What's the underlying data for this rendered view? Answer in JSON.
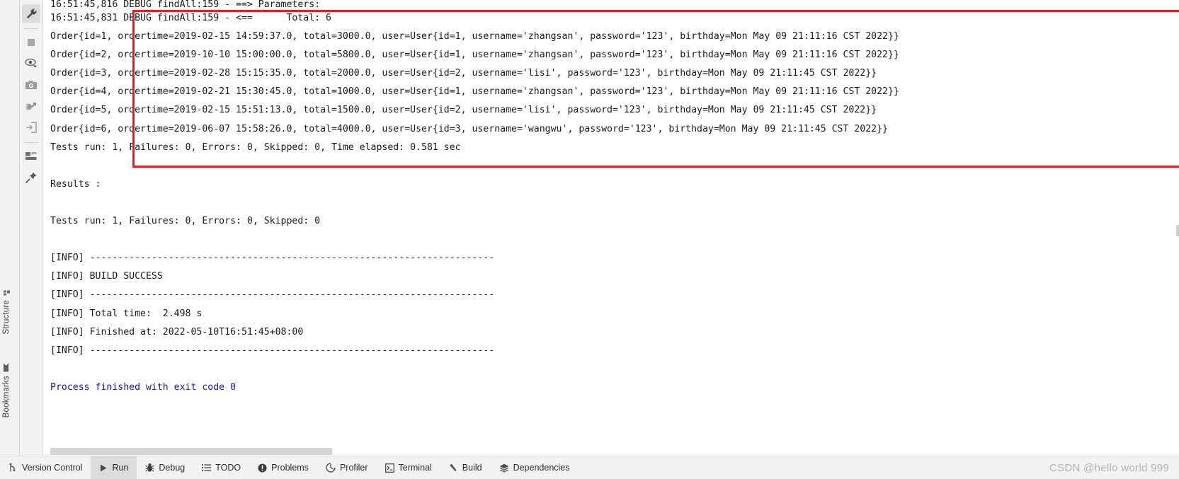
{
  "left_strip": {
    "structure_label": "Structure",
    "bookmarks_label": "Bookmarks",
    "structure_icon": "structure-icon",
    "bookmarks_icon": "bookmark-icon"
  },
  "run_gutter": {
    "buttons": [
      {
        "name": "settings-wrench-icon",
        "title": "Settings",
        "active": true
      },
      {
        "name": "stop-icon",
        "title": "Stop",
        "active": false
      },
      {
        "name": "eye-icon",
        "title": "Filter",
        "active": false
      },
      {
        "name": "camera-icon",
        "title": "Print Screen",
        "active": false
      },
      {
        "name": "rerun-failed-tests-icon",
        "title": "Rerun Failed Tests",
        "active": false
      },
      {
        "name": "export-icon",
        "title": "Export Test Results",
        "active": false
      },
      {
        "name": "layout-icon",
        "title": "Layout",
        "active": false
      },
      {
        "name": "pin-icon",
        "title": "Pin Tab",
        "active": false
      }
    ]
  },
  "console": {
    "lines": [
      {
        "text": "16:51:45,816 DEBUG findAll:159 - ==> Parameters:",
        "style": "plain",
        "clipped": true
      },
      {
        "text": "16:51:45,831 DEBUG findAll:159 - <==      Total: 6",
        "style": "plain"
      },
      {
        "text": "Order{id=1, ordertime=2019-02-15 14:59:37.0, total=3000.0, user=User{id=1, username='zhangsan', password='123', birthday=Mon May 09 21:11:16 CST 2022}}",
        "style": "plain"
      },
      {
        "text": "Order{id=2, ordertime=2019-10-10 15:00:00.0, total=5800.0, user=User{id=1, username='zhangsan', password='123', birthday=Mon May 09 21:11:16 CST 2022}}",
        "style": "plain"
      },
      {
        "text": "Order{id=3, ordertime=2019-02-28 15:15:35.0, total=2000.0, user=User{id=2, username='lisi', password='123', birthday=Mon May 09 21:11:45 CST 2022}}",
        "style": "plain"
      },
      {
        "text": "Order{id=4, ordertime=2019-02-21 15:30:45.0, total=1000.0, user=User{id=1, username='zhangsan', password='123', birthday=Mon May 09 21:11:16 CST 2022}}",
        "style": "plain"
      },
      {
        "text": "Order{id=5, ordertime=2019-02-15 15:51:13.0, total=1500.0, user=User{id=2, username='lisi', password='123', birthday=Mon May 09 21:11:45 CST 2022}}",
        "style": "plain"
      },
      {
        "text": "Order{id=6, ordertime=2019-06-07 15:58:26.0, total=4000.0, user=User{id=3, username='wangwu', password='123', birthday=Mon May 09 21:11:45 CST 2022}}",
        "style": "plain"
      },
      {
        "text": "Tests run: 1, Failures: 0, Errors: 0, Skipped: 0, Time elapsed: 0.581 sec",
        "style": "plain"
      },
      {
        "text": "",
        "style": "plain"
      },
      {
        "text": "Results :",
        "style": "plain"
      },
      {
        "text": "",
        "style": "plain"
      },
      {
        "text": "Tests run: 1, Failures: 0, Errors: 0, Skipped: 0",
        "style": "plain"
      },
      {
        "text": "",
        "style": "plain"
      },
      {
        "text": "[INFO] ------------------------------------------------------------------------",
        "style": "plain"
      },
      {
        "text": "[INFO] BUILD SUCCESS",
        "style": "plain"
      },
      {
        "text": "[INFO] ------------------------------------------------------------------------",
        "style": "plain"
      },
      {
        "text": "[INFO] Total time:  2.498 s",
        "style": "plain"
      },
      {
        "text": "[INFO] Finished at: 2022-05-10T16:51:45+08:00",
        "style": "plain"
      },
      {
        "text": "[INFO] ------------------------------------------------------------------------",
        "style": "plain"
      },
      {
        "text": "",
        "style": "plain"
      },
      {
        "text": "Process finished with exit code 0",
        "style": "blue"
      }
    ],
    "highlight_box_color": "#ee1b24"
  },
  "bottom_bar": {
    "tabs": [
      {
        "label": "Version Control",
        "icon": "branch-icon",
        "selected": false
      },
      {
        "label": "Run",
        "icon": "play-icon",
        "selected": true
      },
      {
        "label": "Debug",
        "icon": "bug-icon",
        "selected": false
      },
      {
        "label": "TODO",
        "icon": "list-icon",
        "selected": false
      },
      {
        "label": "Problems",
        "icon": "warning-icon",
        "selected": false
      },
      {
        "label": "Profiler",
        "icon": "profiler-icon",
        "selected": false
      },
      {
        "label": "Terminal",
        "icon": "terminal-icon",
        "selected": false
      },
      {
        "label": "Build",
        "icon": "hammer-icon",
        "selected": false
      },
      {
        "label": "Dependencies",
        "icon": "layers-icon",
        "selected": false
      }
    ],
    "watermark": "CSDN @hello world 999"
  }
}
